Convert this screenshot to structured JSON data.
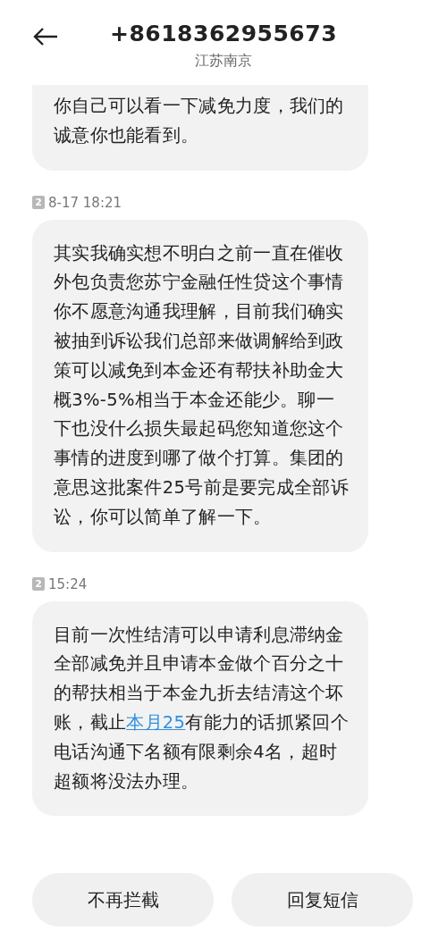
{
  "header": {
    "title": "+8618362955673",
    "subtitle": "江苏南京"
  },
  "messages": [
    {
      "cut_top": true,
      "segments": [
        {
          "kind": "text",
          "text": "你自己可以看一下减免力度，我们的诚意你也能看到。"
        }
      ]
    },
    {
      "timestamp": "8-17 18:21",
      "sim": "2",
      "cut_top": false,
      "segments": [
        {
          "kind": "text",
          "text": "其实我确实想不明白之前一直在催收外包负责您苏宁金融任性贷这个事情你不愿意沟通我理解，目前我们确实被抽到诉讼我们总部来做调解给到政策可以减免到本金还有帮扶补助金大概3%-5%相当于本金还能少。聊一下也没什么损失最起码您知道您这个事情的进度到哪了做个打算。集团的意思这批案件25号前是要完成全部诉讼，你可以简单了解一下。"
        }
      ]
    },
    {
      "timestamp": "15:24",
      "sim": "2",
      "cut_top": false,
      "segments": [
        {
          "kind": "text",
          "text": "目前一次性结清可以申请利息滞纳金全部减免并且申请本金做个百分之十的帮扶相当于本金九折去结清这个坏账，截止"
        },
        {
          "kind": "link",
          "text": "本月25"
        },
        {
          "kind": "text",
          "text": "有能力的话抓紧回个电话沟通下名额有限剩余4名，超时超额将没法办理。"
        }
      ]
    }
  ],
  "buttons": [
    "不再拦截",
    "回复短信"
  ]
}
